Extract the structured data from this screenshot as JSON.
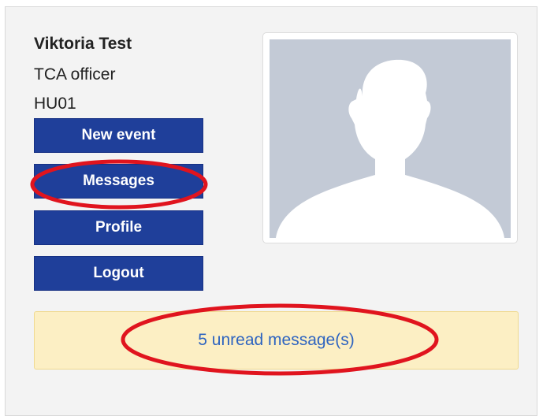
{
  "user": {
    "name": "Viktoria Test",
    "role": "TCA officer",
    "unit": "HU01"
  },
  "nav": {
    "new_event": "New event",
    "messages": "Messages",
    "profile": "Profile",
    "logout": "Logout"
  },
  "notice": {
    "unread_text": "5 unread message(s)"
  },
  "annotation_color": "#e0141e",
  "icons": {
    "avatar": "user-silhouette-icon"
  }
}
